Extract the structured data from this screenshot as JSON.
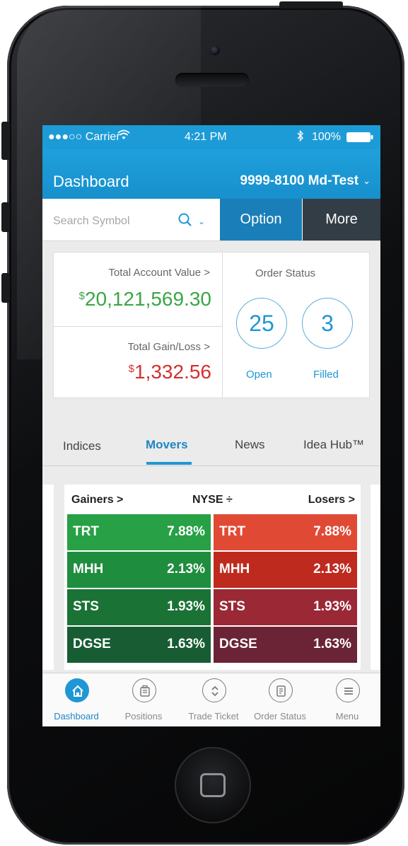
{
  "status_bar": {
    "carrier": "●●●○○ Carrier",
    "time": "4:21 PM",
    "battery": "100%"
  },
  "header": {
    "title": "Dashboard",
    "account": "9999-8100 Md-Test"
  },
  "search": {
    "placeholder": "Search Symbol",
    "option_label": "Option",
    "more_label": "More"
  },
  "summary": {
    "total_account_value_label": "Total Account Value >",
    "total_account_value_currency": "$",
    "total_account_value": "20,121,569.30",
    "total_gain_loss_label": "Total Gain/Loss >",
    "total_gain_loss_currency": "$",
    "total_gain_loss": "1,332.56",
    "order_status_label": "Order Status",
    "open_count": "25",
    "open_label": "Open",
    "filled_count": "3",
    "filled_label": "Filled"
  },
  "tabs": [
    {
      "label": "Indices"
    },
    {
      "label": "Movers",
      "active": true
    },
    {
      "label": "News"
    },
    {
      "label": "Idea Hub™"
    }
  ],
  "movers": {
    "gainers_label": "Gainers >",
    "exchange_label": "NYSE ÷",
    "losers_label": "Losers >",
    "gainers": [
      {
        "symbol": "TRT",
        "change": "7.88%",
        "color": "#27a046"
      },
      {
        "symbol": "MHH",
        "change": "2.13%",
        "color": "#1f8d3e"
      },
      {
        "symbol": "STS",
        "change": "1.93%",
        "color": "#1a7235"
      },
      {
        "symbol": "DGSE",
        "change": "1.63%",
        "color": "#175c33"
      }
    ],
    "losers": [
      {
        "symbol": "TRT",
        "change": "7.88%",
        "color": "#e04a35"
      },
      {
        "symbol": "MHH",
        "change": "2.13%",
        "color": "#bf2a1e"
      },
      {
        "symbol": "STS",
        "change": "1.93%",
        "color": "#9a2835"
      },
      {
        "symbol": "DGSE",
        "change": "1.63%",
        "color": "#6a2435"
      }
    ]
  },
  "tab_bar": [
    {
      "label": "Dashboard",
      "icon": "home-icon",
      "active": true
    },
    {
      "label": "Positions",
      "icon": "briefcase-icon"
    },
    {
      "label": "Trade Ticket",
      "icon": "trade-icon"
    },
    {
      "label": "Order Status",
      "icon": "order-icon"
    },
    {
      "label": "Menu",
      "icon": "menu-icon"
    }
  ],
  "colors": {
    "accent": "#1f97d5",
    "gain": "#3aa646",
    "loss": "#d2312e",
    "more_button": "#333d45"
  }
}
